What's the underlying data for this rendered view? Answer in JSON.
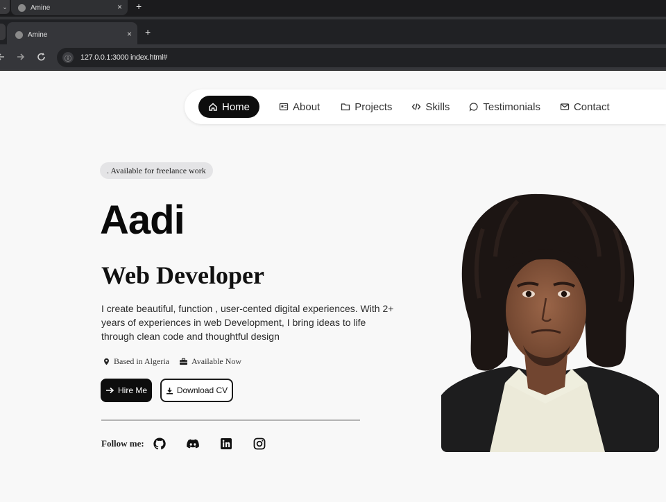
{
  "browser": {
    "back_tab": {
      "title": "Amine",
      "close": "×",
      "new": "+"
    },
    "active_tab": {
      "title": "Amine",
      "close": "×",
      "new": "+"
    },
    "url": "127.0.0.1:3000 index.html#",
    "nav_icons": [
      "back-icon",
      "forward-icon",
      "reload-icon",
      "site-info-icon"
    ]
  },
  "navbar": {
    "items": [
      {
        "label": "Home",
        "icon": "home-icon",
        "active": true
      },
      {
        "label": "About",
        "icon": "id-card-icon",
        "active": false
      },
      {
        "label": "Projects",
        "icon": "folder-icon",
        "active": false
      },
      {
        "label": "Skills",
        "icon": "code-icon",
        "active": false
      },
      {
        "label": "Testimonials",
        "icon": "chat-icon",
        "active": false
      },
      {
        "label": "Contact",
        "icon": "mail-icon",
        "active": false
      }
    ]
  },
  "hero": {
    "badge": ". Available for freelance work",
    "name": "Aadi",
    "role": "Web Developer",
    "description": "I create beautiful, function , user-cented digital experiences. With 2+ years of experiences in web Development, I bring ideas to life through clean code and thoughtful design",
    "location": "Based in Algeria",
    "availability": "Available Now",
    "hire_label": "Hire Me",
    "cv_label": "Download CV",
    "follow_label": "Follow me:",
    "socials": [
      "github-icon",
      "discord-icon",
      "linkedin-icon",
      "instagram-icon"
    ]
  },
  "colors": {
    "accent": "#0d0d0d",
    "page_bg": "#f8f8f8",
    "badge_bg": "#e4e4e6"
  }
}
